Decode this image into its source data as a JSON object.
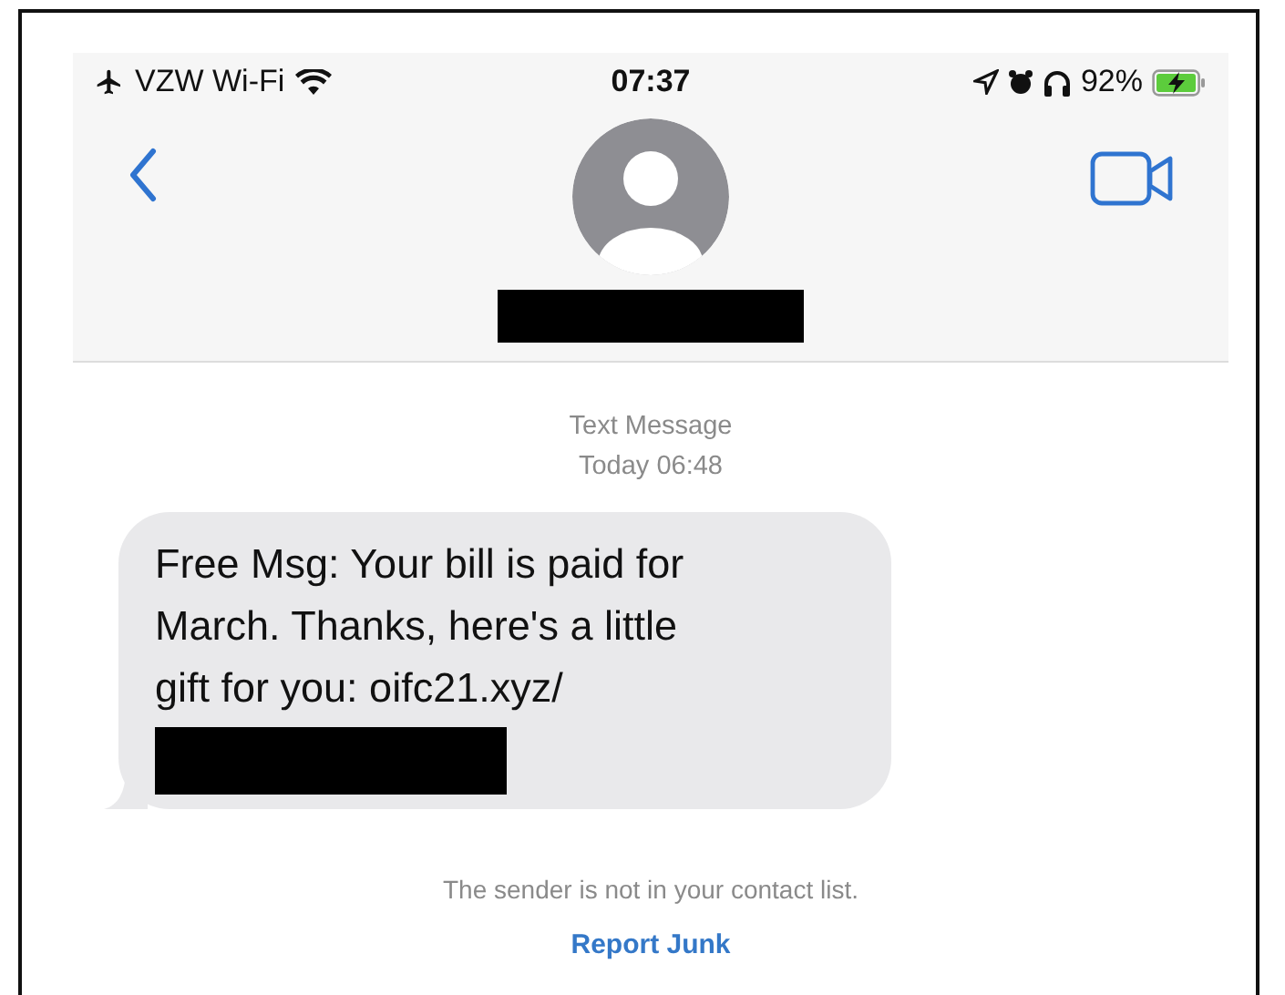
{
  "status_bar": {
    "carrier": "VZW Wi-Fi",
    "time": "07:37",
    "battery": "92%"
  },
  "conversation": {
    "service": "Text Message",
    "timestamp": "Today 06:48"
  },
  "messages": [
    {
      "text": "Free Msg: Your bill is paid for\nMarch. Thanks, here's a little\ngift for you: oifc21.xyz/"
    }
  ],
  "notice": "The sender is not in your contact list.",
  "report_link": "Report Junk"
}
